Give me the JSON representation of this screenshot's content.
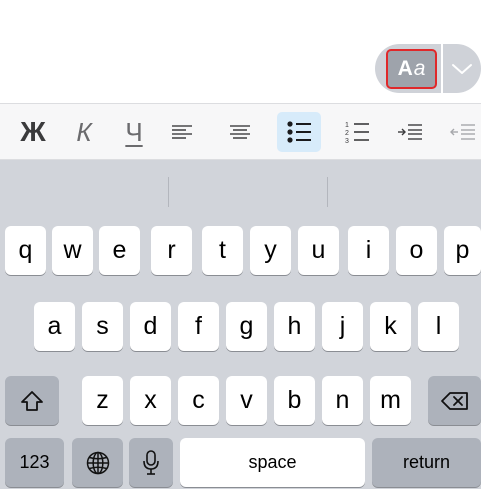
{
  "format_button": {
    "label_bold": "A",
    "label_italic": "a"
  },
  "toolbar": {
    "bold": "Ж",
    "italic": "К",
    "underline": "Ч"
  },
  "keyboard": {
    "row1": [
      "q",
      "w",
      "e",
      "r",
      "t",
      "y",
      "u",
      "i",
      "o",
      "p"
    ],
    "row2": [
      "a",
      "s",
      "d",
      "f",
      "g",
      "h",
      "j",
      "k",
      "l"
    ],
    "row3": [
      "z",
      "x",
      "c",
      "v",
      "b",
      "n",
      "m"
    ],
    "numbers_key": "123",
    "space_key": "space",
    "return_key": "return"
  },
  "colors": {
    "accent_border": "#e0282a",
    "active_toolbar_bg": "#d7ebfa",
    "keyboard_bg": "#d1d4da"
  }
}
